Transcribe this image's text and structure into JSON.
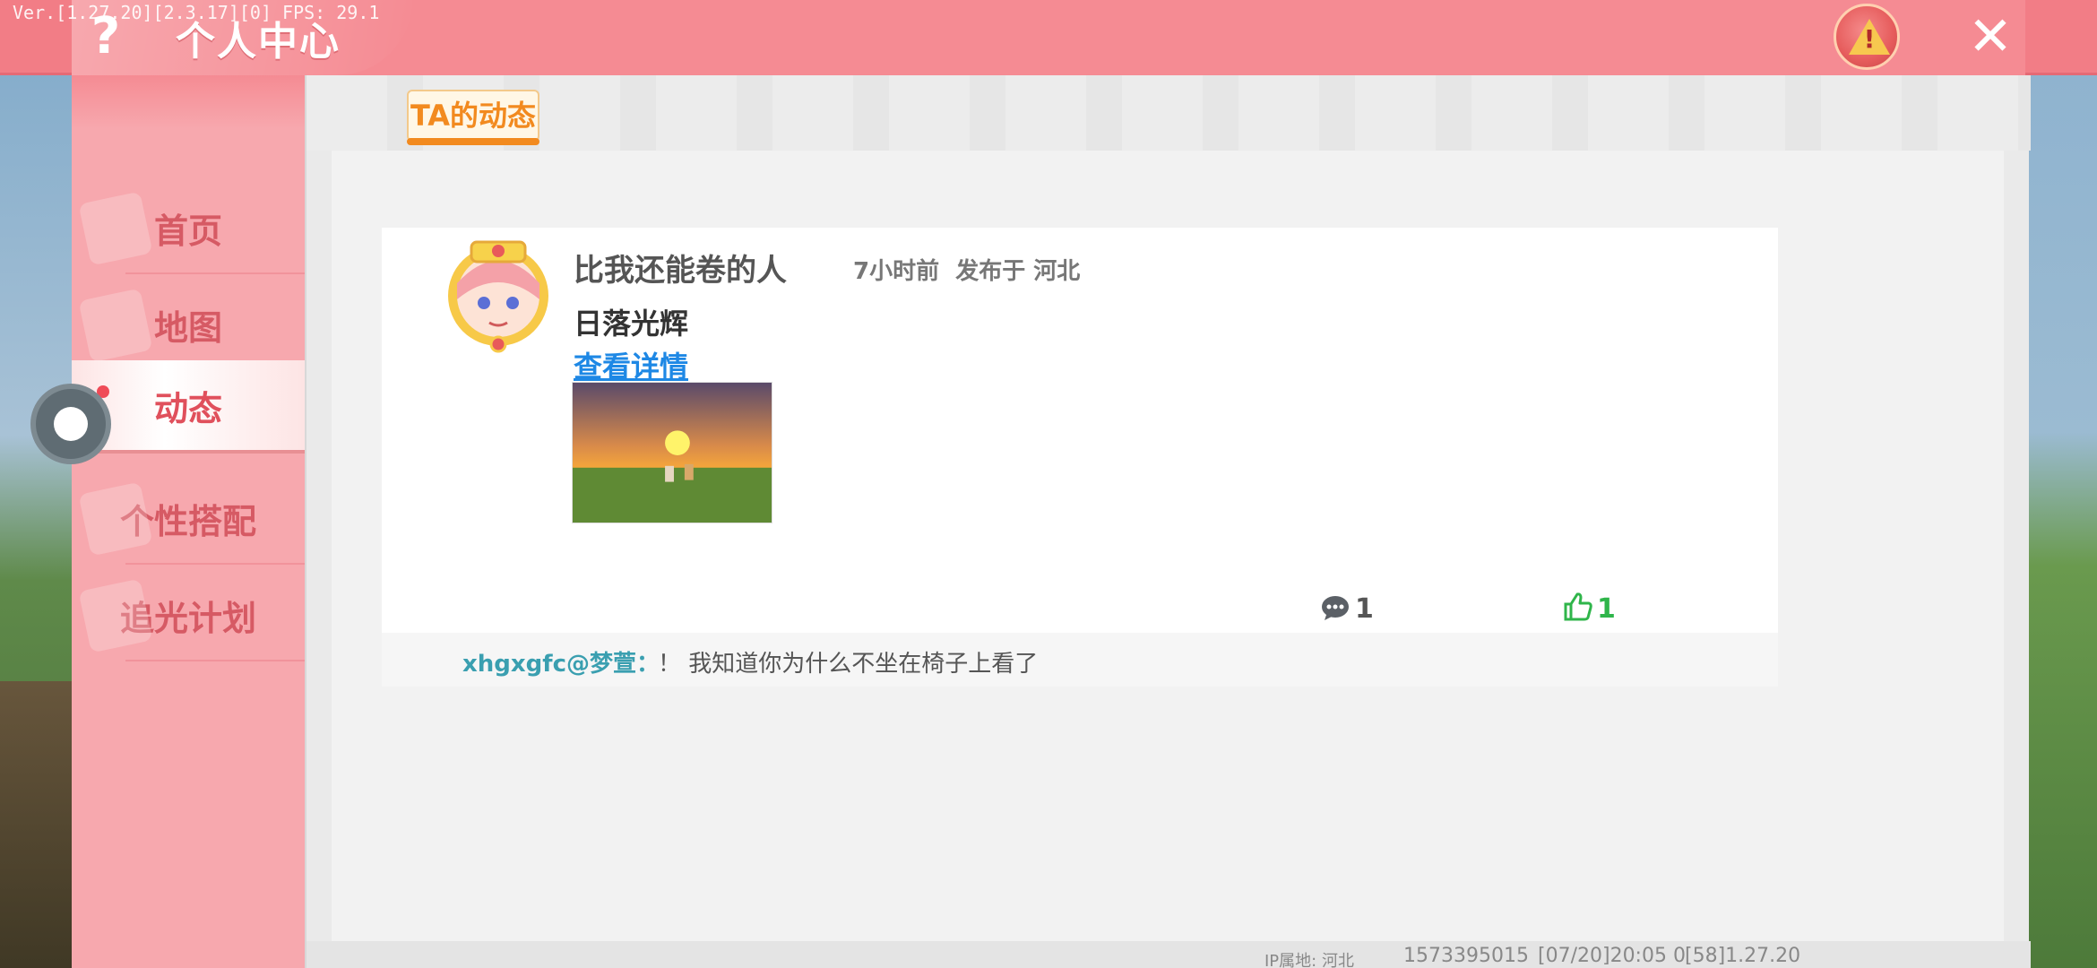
{
  "version": "Ver.[1.27.20][2.3.17][0] FPS: 29.1",
  "header": {
    "title": "个人中心",
    "help_icon": "question-icon",
    "warning_icon": "warning-icon",
    "close_icon": "close-icon"
  },
  "colors": {
    "header": "#f27d86",
    "sidebar": "#f7a8ae",
    "accent_orange": "#f28a1f",
    "link_blue": "#1e88e5",
    "like_green": "#2fb54a",
    "comment_user": "#3a9fb0"
  },
  "sidebar": {
    "items": [
      {
        "label": "首页",
        "active": false
      },
      {
        "label": "地图",
        "active": false
      },
      {
        "label": "动态",
        "active": true
      },
      {
        "label": "个性搭配",
        "active": false
      },
      {
        "label": "追光计划",
        "active": false
      }
    ]
  },
  "main": {
    "tab_label": "TA的动态",
    "post": {
      "title": "比我还能卷的人",
      "time": "7小时前",
      "location": "发布于 河北",
      "text": "日落光辉",
      "link": "查看详情",
      "comment_count": "1",
      "like_count": "1"
    },
    "comment": {
      "user": "xhgxgfc@梦萱：",
      "text": "！ 我知道你为什么不坐在椅子上看了"
    }
  },
  "footer": {
    "ip": "IP属地: 河北",
    "id": "1573395015",
    "time": "[07/20]20:05 0",
    "ver": "[58]1.27.20"
  }
}
